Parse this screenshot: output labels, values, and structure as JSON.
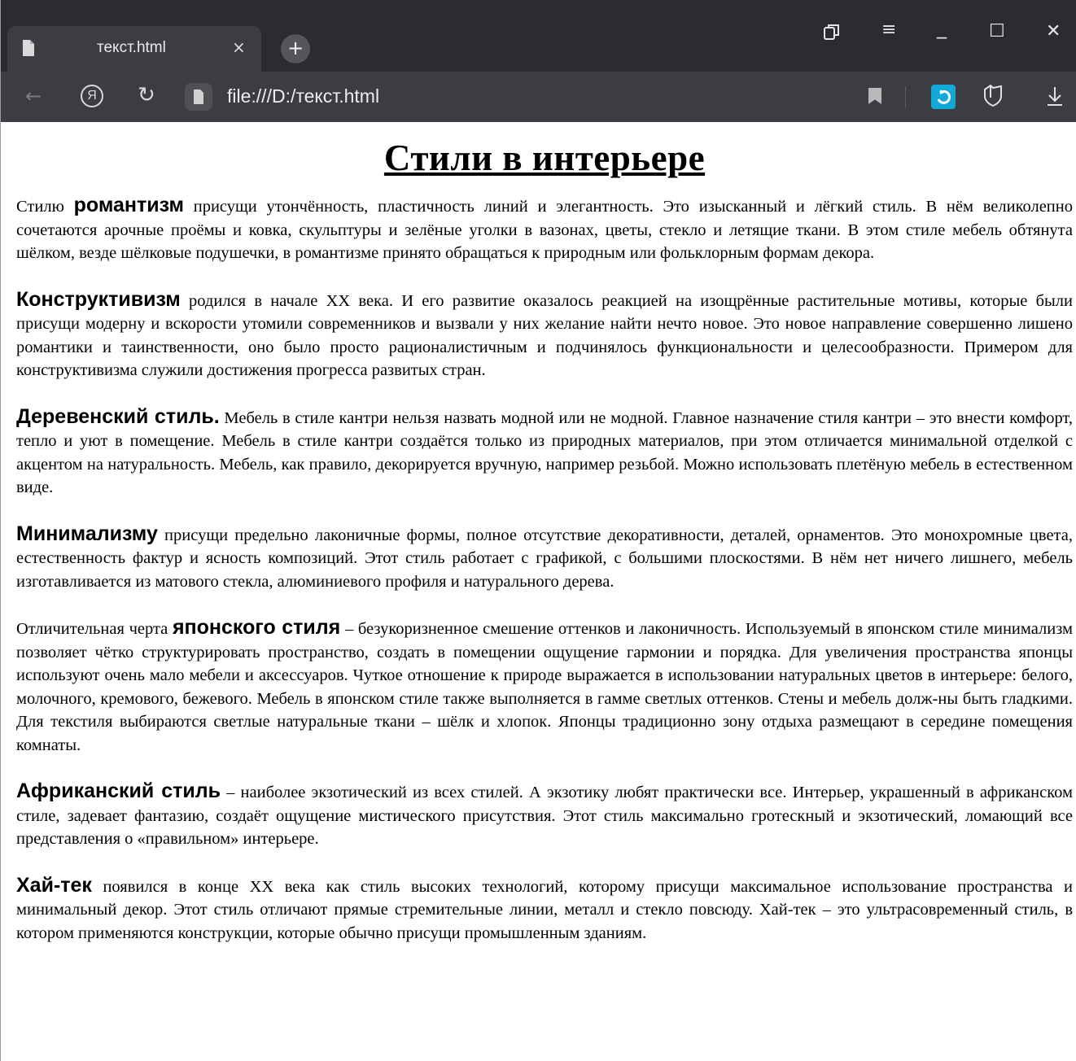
{
  "browser": {
    "tab_title": "текст.html",
    "tab_close": "×",
    "new_tab": "+",
    "url": "file:///D:/текст.html",
    "ya_letter": "Я",
    "controls": {
      "minimize": "_",
      "maximize": "☐",
      "close": "✕",
      "menu": "≡"
    }
  },
  "page": {
    "title": "Стили в интерьере",
    "paragraphs": [
      {
        "before": "Стилю ",
        "keyword": "романтизм",
        "after": " присущи утончённость, пластичность линий и элегантность. Это изысканный и лёгкий стиль. В нём великолепно сочетаются арочные проёмы и ковка, скульптуры и зелёные уголки в вазонах, цветы, стекло и летящие ткани. В этом стиле мебель обтянута шёлком, везде шёлковые подушечки, в романтизме принято обращаться к природным или фольклорным формам декора."
      },
      {
        "before": "",
        "keyword": "Конструктивизм",
        "after": " родился в начале XX века. И его развитие оказалось реакцией на изощрённые растительные мотивы, которые были присущи модерну и вскорости утомили современников и вызвали у них желание найти нечто новое. Это новое направление совершенно лишено романтики и таинственности, оно было просто рационалистичным и подчинялось функциональности и целесообразности. Примером для конструктивизма служили достижения прогресса развитых стран."
      },
      {
        "before": "",
        "keyword": "Деревенский стиль.",
        "after": " Мебель в стиле кантри нельзя назвать модной или не модной. Главное назначение стиля кантри – это внести комфорт, тепло и уют в помещение. Мебель в стиле кантри создаётся только из природных материалов, при этом отличается минимальной отделкой с акцентом на натуральность. Мебель, как правило, декорируется вручную, например резьбой. Можно использовать плетёную мебель в естественном виде."
      },
      {
        "before": "",
        "keyword": "Минимализму",
        "after": " присущи предельно лаконичные формы, полное отсутствие декоративности, деталей, орнаментов. Это монохромные цвета, естественность фактур и ясность композиций. Этот стиль работает с графикой, с большими плоскостями. В нём нет ничего лишнего, мебель изготавливается из матового стекла, алюминиевого профиля и натурального дерева."
      },
      {
        "before": "Отличительная черта ",
        "keyword": "японского стиля",
        "after": " – безукоризненное смешение оттенков и лаконичность. Используемый в японском стиле минимализм позволяет чётко структурировать пространство, создать в помещении ощущение гармонии и порядка. Для увеличения пространства японцы используют очень мало мебели и аксессуаров. Чуткое отношение к природе выражается в использовании натуральных цветов в интерьере: белого, молочного, кремового, бежевого. Мебель в японском стиле также выполняется в гамме светлых оттенков. Стены и мебель долж-ны быть гладкими. Для текстиля выбираются светлые натуральные ткани – шёлк и хлопок. Японцы традиционно зону отдыха размещают в середине помещения комнаты."
      },
      {
        "before": "",
        "keyword": "Африканский стиль",
        "after": " – наиболее экзотический из всех стилей. А экзотику любят практически все. Интерьер, украшенный в африканском стиле, задевает фантазию, создаёт ощущение мистического присутствия. Этот стиль максимально гротескный и экзотический, ломающий все представления о «правильном» интерьере."
      },
      {
        "before": "",
        "keyword": "Хай-тек",
        "after": " появился в конце XX века как стиль высоких технологий, которому присущи максимальное использование пространства и минимальный декор. Этот стиль отличают прямые стремительные линии, металл и стекло повсюду. Хай-тек – это ультрасовременный стиль, в котором применяются конструкции, которые обычно присущи промышленным зданиям."
      }
    ]
  }
}
